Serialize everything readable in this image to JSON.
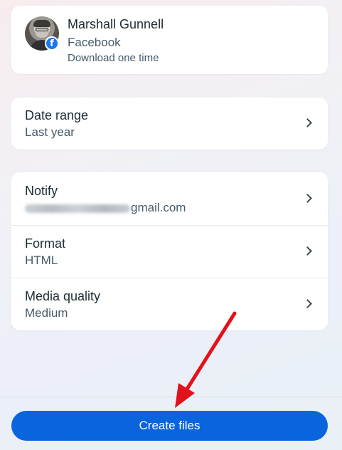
{
  "profile": {
    "name": "Marshall Gunnell",
    "platform": "Facebook",
    "frequency": "Download one time",
    "badge_icon": "facebook-icon"
  },
  "date_range": {
    "title": "Date range",
    "value": "Last year"
  },
  "notify": {
    "title": "Notify",
    "email_visible_suffix": "gmail.com"
  },
  "format": {
    "title": "Format",
    "value": "HTML"
  },
  "media_quality": {
    "title": "Media quality",
    "value": "Medium"
  },
  "actions": {
    "create_label": "Create files"
  },
  "colors": {
    "primary": "#0a64de",
    "facebook": "#1877f2",
    "annotation_arrow": "#e3111b"
  }
}
